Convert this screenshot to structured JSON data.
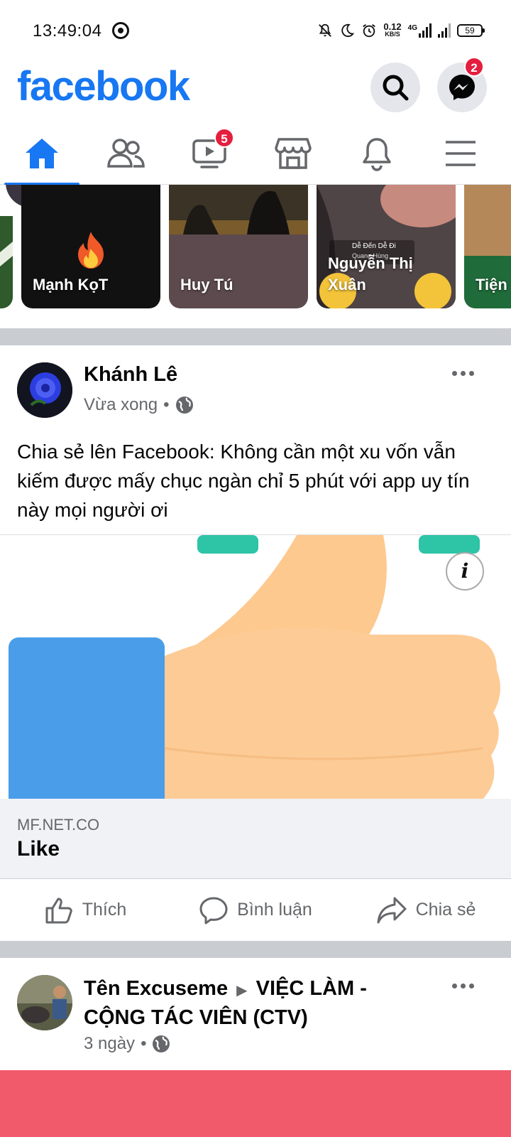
{
  "status_bar": {
    "time": "13:49:04",
    "net_speed_value": "0.12",
    "net_speed_unit": "KB/S",
    "network_type": "4G",
    "battery": "59"
  },
  "header": {
    "logo": "facebook",
    "messenger_badge": "2"
  },
  "nav": {
    "tabs": [
      {
        "name": "home",
        "icon": "home-icon",
        "active": true
      },
      {
        "name": "friends",
        "icon": "friends-icon"
      },
      {
        "name": "watch",
        "icon": "video-icon",
        "badge": "5"
      },
      {
        "name": "marketplace",
        "icon": "store-icon"
      },
      {
        "name": "notifications",
        "icon": "bell-icon"
      },
      {
        "name": "menu",
        "icon": "hamburger-icon"
      }
    ],
    "watch_badge": "5"
  },
  "stories": {
    "items": [
      {
        "name": "Mạnh KọT"
      },
      {
        "name": "Huy Tú"
      },
      {
        "name": "Nguyễn Thị Xuân",
        "music_title": "Dễ Đến Dễ Đi",
        "music_artist": "Quang Hùng"
      },
      {
        "name": "Tiện Cha"
      }
    ]
  },
  "post1": {
    "author": "Khánh Lê",
    "time": "Vừa xong",
    "text": "Chia sẻ lên Facebook: Không cần một xu vốn vẫn kiếm được mấy chục ngàn chỉ 5 phút với app uy tín này mọi người ơi",
    "link_domain": "MF.NET.CO",
    "link_title": "Like",
    "info_label": "i"
  },
  "actions": {
    "like": "Thích",
    "comment": "Bình luận",
    "share": "Chia sẻ"
  },
  "post2": {
    "author": "Tên Excuseme",
    "group": "VIỆC LÀM - CỘNG TÁC VIÊN (CTV)",
    "arrow": "▶",
    "time": "3 ngày"
  },
  "colors": {
    "brand": "#1877f2",
    "badge": "#e41e3f",
    "separator": "#c9ccd1"
  }
}
